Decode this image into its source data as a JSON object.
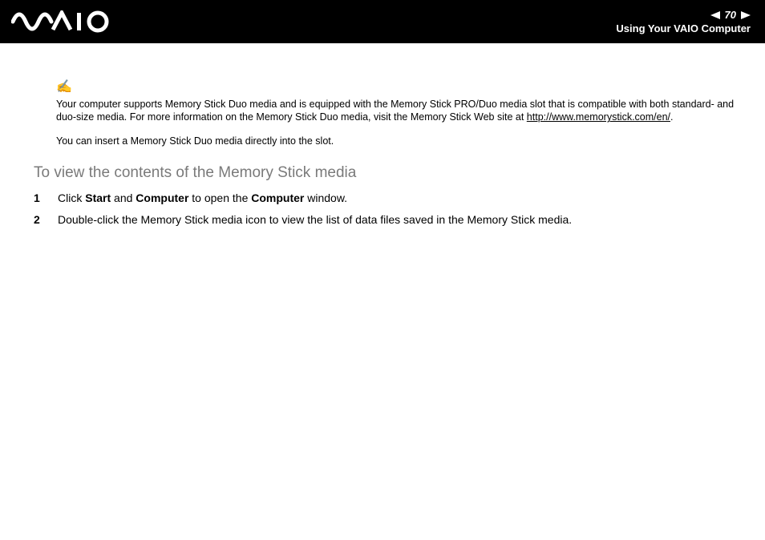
{
  "header": {
    "page_number": "70",
    "section": "Using Your VAIO Computer"
  },
  "note": {
    "text_before_link": "Your computer supports Memory Stick Duo media and is equipped with the Memory Stick PRO/Duo media slot that is compatible with both standard- and duo-size media. For more information on the Memory Stick Duo media, visit the Memory Stick Web site at ",
    "link_text": "http://www.memorystick.com/en/",
    "text_after_link": "."
  },
  "plain_line": "You can insert a Memory Stick Duo media directly into the slot.",
  "heading": "To view the contents of the Memory Stick media",
  "steps": {
    "s1": {
      "num": "1",
      "p1": "Click ",
      "b1": "Start",
      "p2": " and ",
      "b2": "Computer",
      "p3": " to open the ",
      "b3": "Computer",
      "p4": " window."
    },
    "s2": {
      "num": "2",
      "text": "Double-click the Memory Stick media icon to view the list of data files saved in the Memory Stick media."
    }
  }
}
